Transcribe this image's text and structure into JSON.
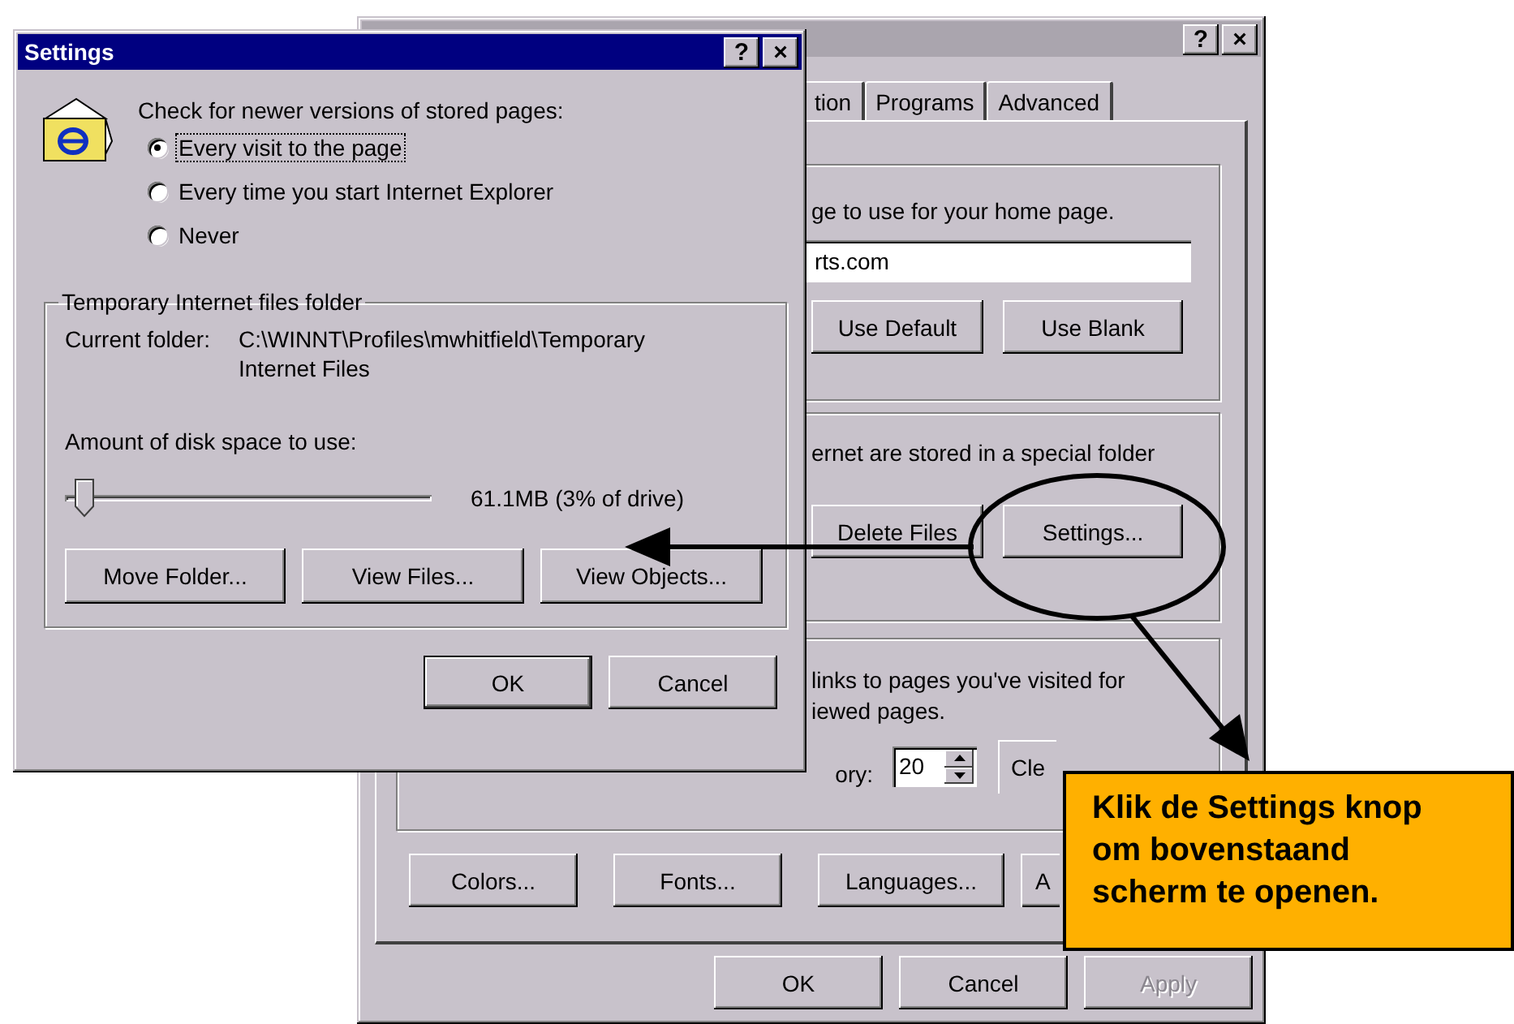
{
  "background_window": {
    "title_buttons": [
      "?",
      "×"
    ],
    "tabs": [
      {
        "label": "tion",
        "selected": false
      },
      {
        "label": "Programs",
        "selected": false
      },
      {
        "label": "Advanced",
        "selected": false
      }
    ],
    "home_page": {
      "text": "ge to use for your home page.",
      "address": "rts.com",
      "buttons": [
        "Use Default",
        "Use Blank"
      ]
    },
    "temporary_files": {
      "text": "ernet are stored in a special folder",
      "buttons": [
        "Delete Files",
        "Settings..."
      ]
    },
    "history": {
      "text_lines": [
        "links to pages you've visited for",
        "iewed pages."
      ],
      "days_label": "ory:",
      "days": "20",
      "button": "Cle"
    },
    "buttons": [
      "Colors...",
      "Fonts...",
      "Languages...",
      "A"
    ],
    "dialog_buttons": [
      {
        "label": "OK",
        "disabled": false
      },
      {
        "label": "Cancel",
        "disabled": false
      },
      {
        "label": "Apply",
        "disabled": true
      }
    ]
  },
  "settings_dialog": {
    "title": "Settings",
    "title_buttons": [
      "?",
      "×"
    ],
    "check_label": "Check for newer versions of stored pages:",
    "options": [
      {
        "label": "Every visit to the page",
        "selected": true
      },
      {
        "label": "Every time you start Internet Explorer",
        "selected": false
      },
      {
        "label": "Never",
        "selected": false
      }
    ],
    "group": {
      "title": "Temporary Internet files folder",
      "current_folder_label": "Current folder:",
      "current_folder": "C:\\WINNT\\Profiles\\mwhitfield\\Temporary Internet Files",
      "disk_space_label": "Amount of disk space to use:",
      "disk_space": {
        "level": 0.03
      },
      "disk_space_reading": "61.1MB (3% of drive)",
      "buttons": [
        "Move Folder...",
        "View Files...",
        "View Objects..."
      ]
    },
    "buttons": [
      "OK",
      "Cancel"
    ]
  },
  "callout": {
    "text": "Klik de Settings knop om bovenstaand scherm te openen."
  }
}
